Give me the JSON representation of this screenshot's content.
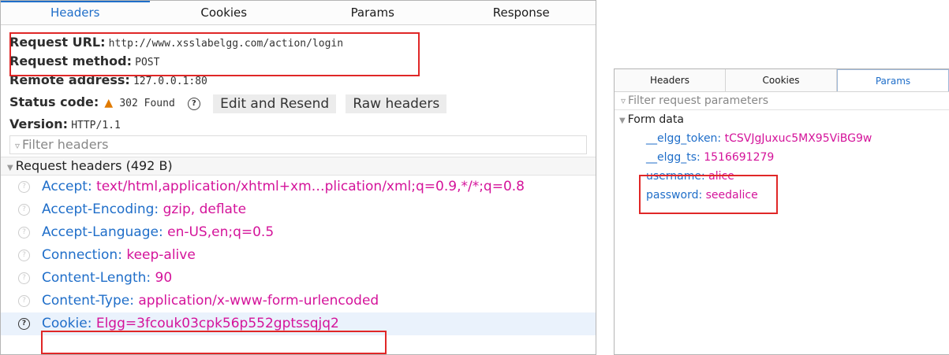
{
  "left": {
    "tabs": [
      "Headers",
      "Cookies",
      "Params",
      "Response"
    ],
    "summary": {
      "url_label": "Request URL:",
      "url_value": "http://www.xsslabelgg.com/action/login",
      "method_label": "Request method:",
      "method_value": "POST",
      "remote_label": "Remote address:",
      "remote_value": "127.0.0.1:80",
      "status_label": "Status code:",
      "status_icon": "warning-triangle-icon",
      "status_value": "302 Found",
      "help_glyph": "?",
      "edit_resend": "Edit and Resend",
      "raw_headers": "Raw headers",
      "version_label": "Version:",
      "version_value": "HTTP/1.1"
    },
    "filter_placeholder": "Filter headers",
    "request_headers_title": "Request headers (492 B)",
    "headers": [
      {
        "key": "Accept:",
        "value": "text/html,application/xhtml+xm…plication/xml;q=0.9,*/*;q=0.8"
      },
      {
        "key": "Accept-Encoding:",
        "value": "gzip, deflate"
      },
      {
        "key": "Accept-Language:",
        "value": "en-US,en;q=0.5"
      },
      {
        "key": "Connection:",
        "value": "keep-alive"
      },
      {
        "key": "Content-Length:",
        "value": "90"
      },
      {
        "key": "Content-Type:",
        "value": "application/x-www-form-urlencoded"
      },
      {
        "key": "Cookie:",
        "value": "Elgg=3fcouk03cpk56p552gptssqjq2"
      }
    ]
  },
  "right": {
    "tabs": [
      "Headers",
      "Cookies",
      "Params"
    ],
    "filter_placeholder": "Filter request parameters",
    "form_data_title": "Form data",
    "params": [
      {
        "key": "__elgg_token:",
        "value": "tCSVJgJuxuc5MX95ViBG9w"
      },
      {
        "key": "__elgg_ts:",
        "value": "1516691279"
      },
      {
        "key": "username:",
        "value": "alice"
      },
      {
        "key": "password:",
        "value": "seedalice"
      }
    ]
  },
  "colors": {
    "accent": "#1f6ec9",
    "value": "#d4139a",
    "highlight_box": "#e02727",
    "warning": "#e07a00"
  }
}
